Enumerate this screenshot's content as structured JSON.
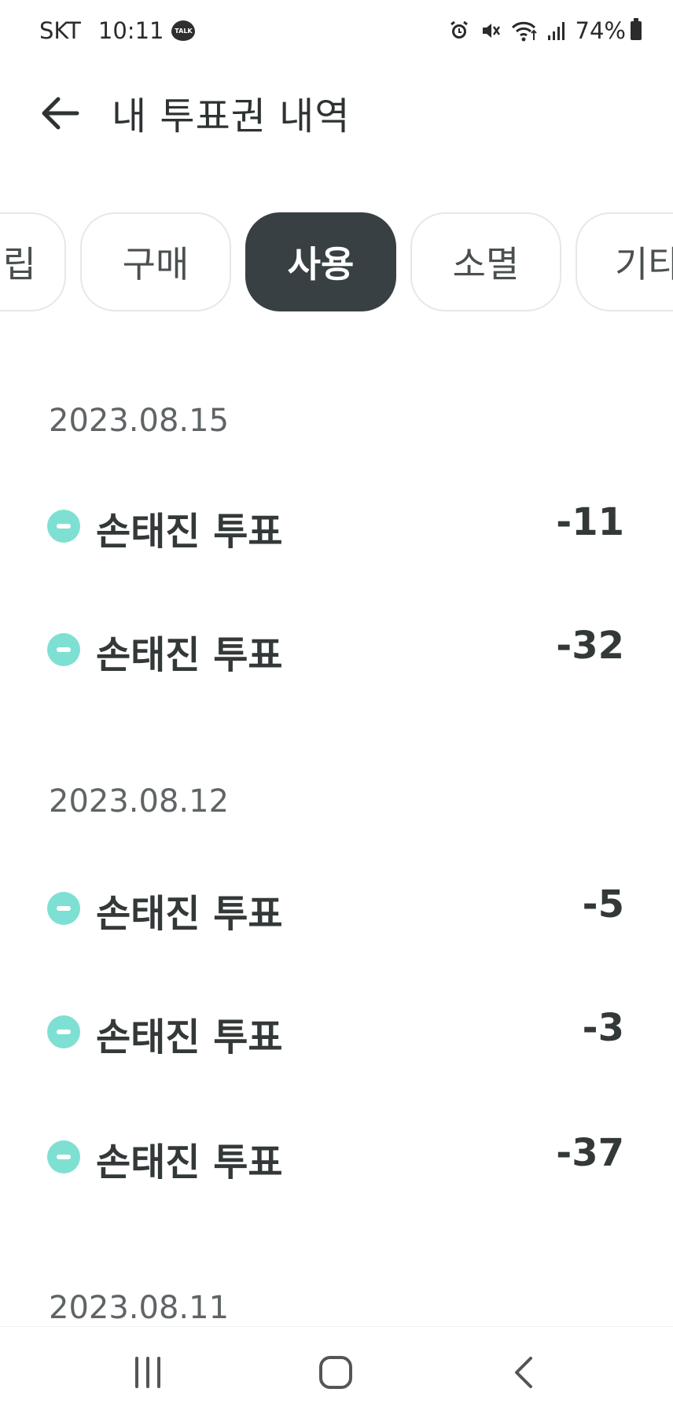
{
  "status_bar": {
    "carrier": "SKT",
    "time": "10:11",
    "talk_badge": "TALK",
    "battery": "74%"
  },
  "header": {
    "title": "내 투표권 내역"
  },
  "tabs": [
    {
      "label": "립",
      "active": false
    },
    {
      "label": "구매",
      "active": false
    },
    {
      "label": "사용",
      "active": true
    },
    {
      "label": "소멸",
      "active": false
    },
    {
      "label": "기타",
      "active": false
    }
  ],
  "groups": [
    {
      "date": "2023.08.15",
      "items": [
        {
          "label": "손태진 투표",
          "amount": "-11"
        },
        {
          "label": "손태진 투표",
          "amount": "-32"
        }
      ]
    },
    {
      "date": "2023.08.12",
      "items": [
        {
          "label": "손태진 투표",
          "amount": "-5"
        },
        {
          "label": "손태진 투표",
          "amount": "-3"
        },
        {
          "label": "손태진 투표",
          "amount": "-37"
        }
      ]
    },
    {
      "date": "2023.08.11",
      "items": []
    }
  ],
  "colors": {
    "accent": "#7ee0d2",
    "active_tab": "#394043"
  }
}
